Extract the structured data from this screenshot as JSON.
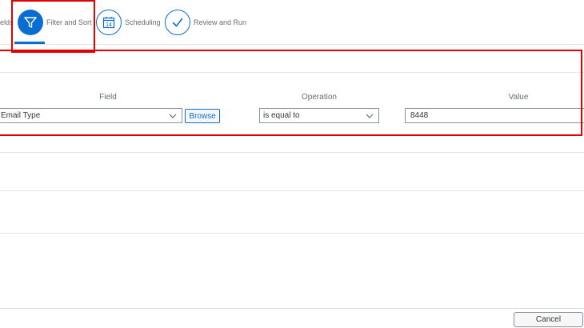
{
  "wizard": {
    "steps": [
      {
        "label": "elds",
        "state": "completed"
      },
      {
        "label": "Filter and Sort",
        "state": "active",
        "icon": "filter-icon"
      },
      {
        "label": "Scheduling",
        "state": "inactive",
        "icon": "calendar-icon",
        "icon_text": "14"
      },
      {
        "label": "Review and Run",
        "state": "inactive",
        "icon": "check-icon"
      }
    ]
  },
  "filter": {
    "headers": {
      "field": "Field",
      "operation": "Operation",
      "value": "Value"
    },
    "row": {
      "field": "Email Type",
      "browse_label": "Browse",
      "operation": "is equal to",
      "value": "8448"
    }
  },
  "footer": {
    "cancel_label": "Cancel"
  },
  "colors": {
    "accent": "#0a6ed1",
    "annotation": "#e00000"
  }
}
